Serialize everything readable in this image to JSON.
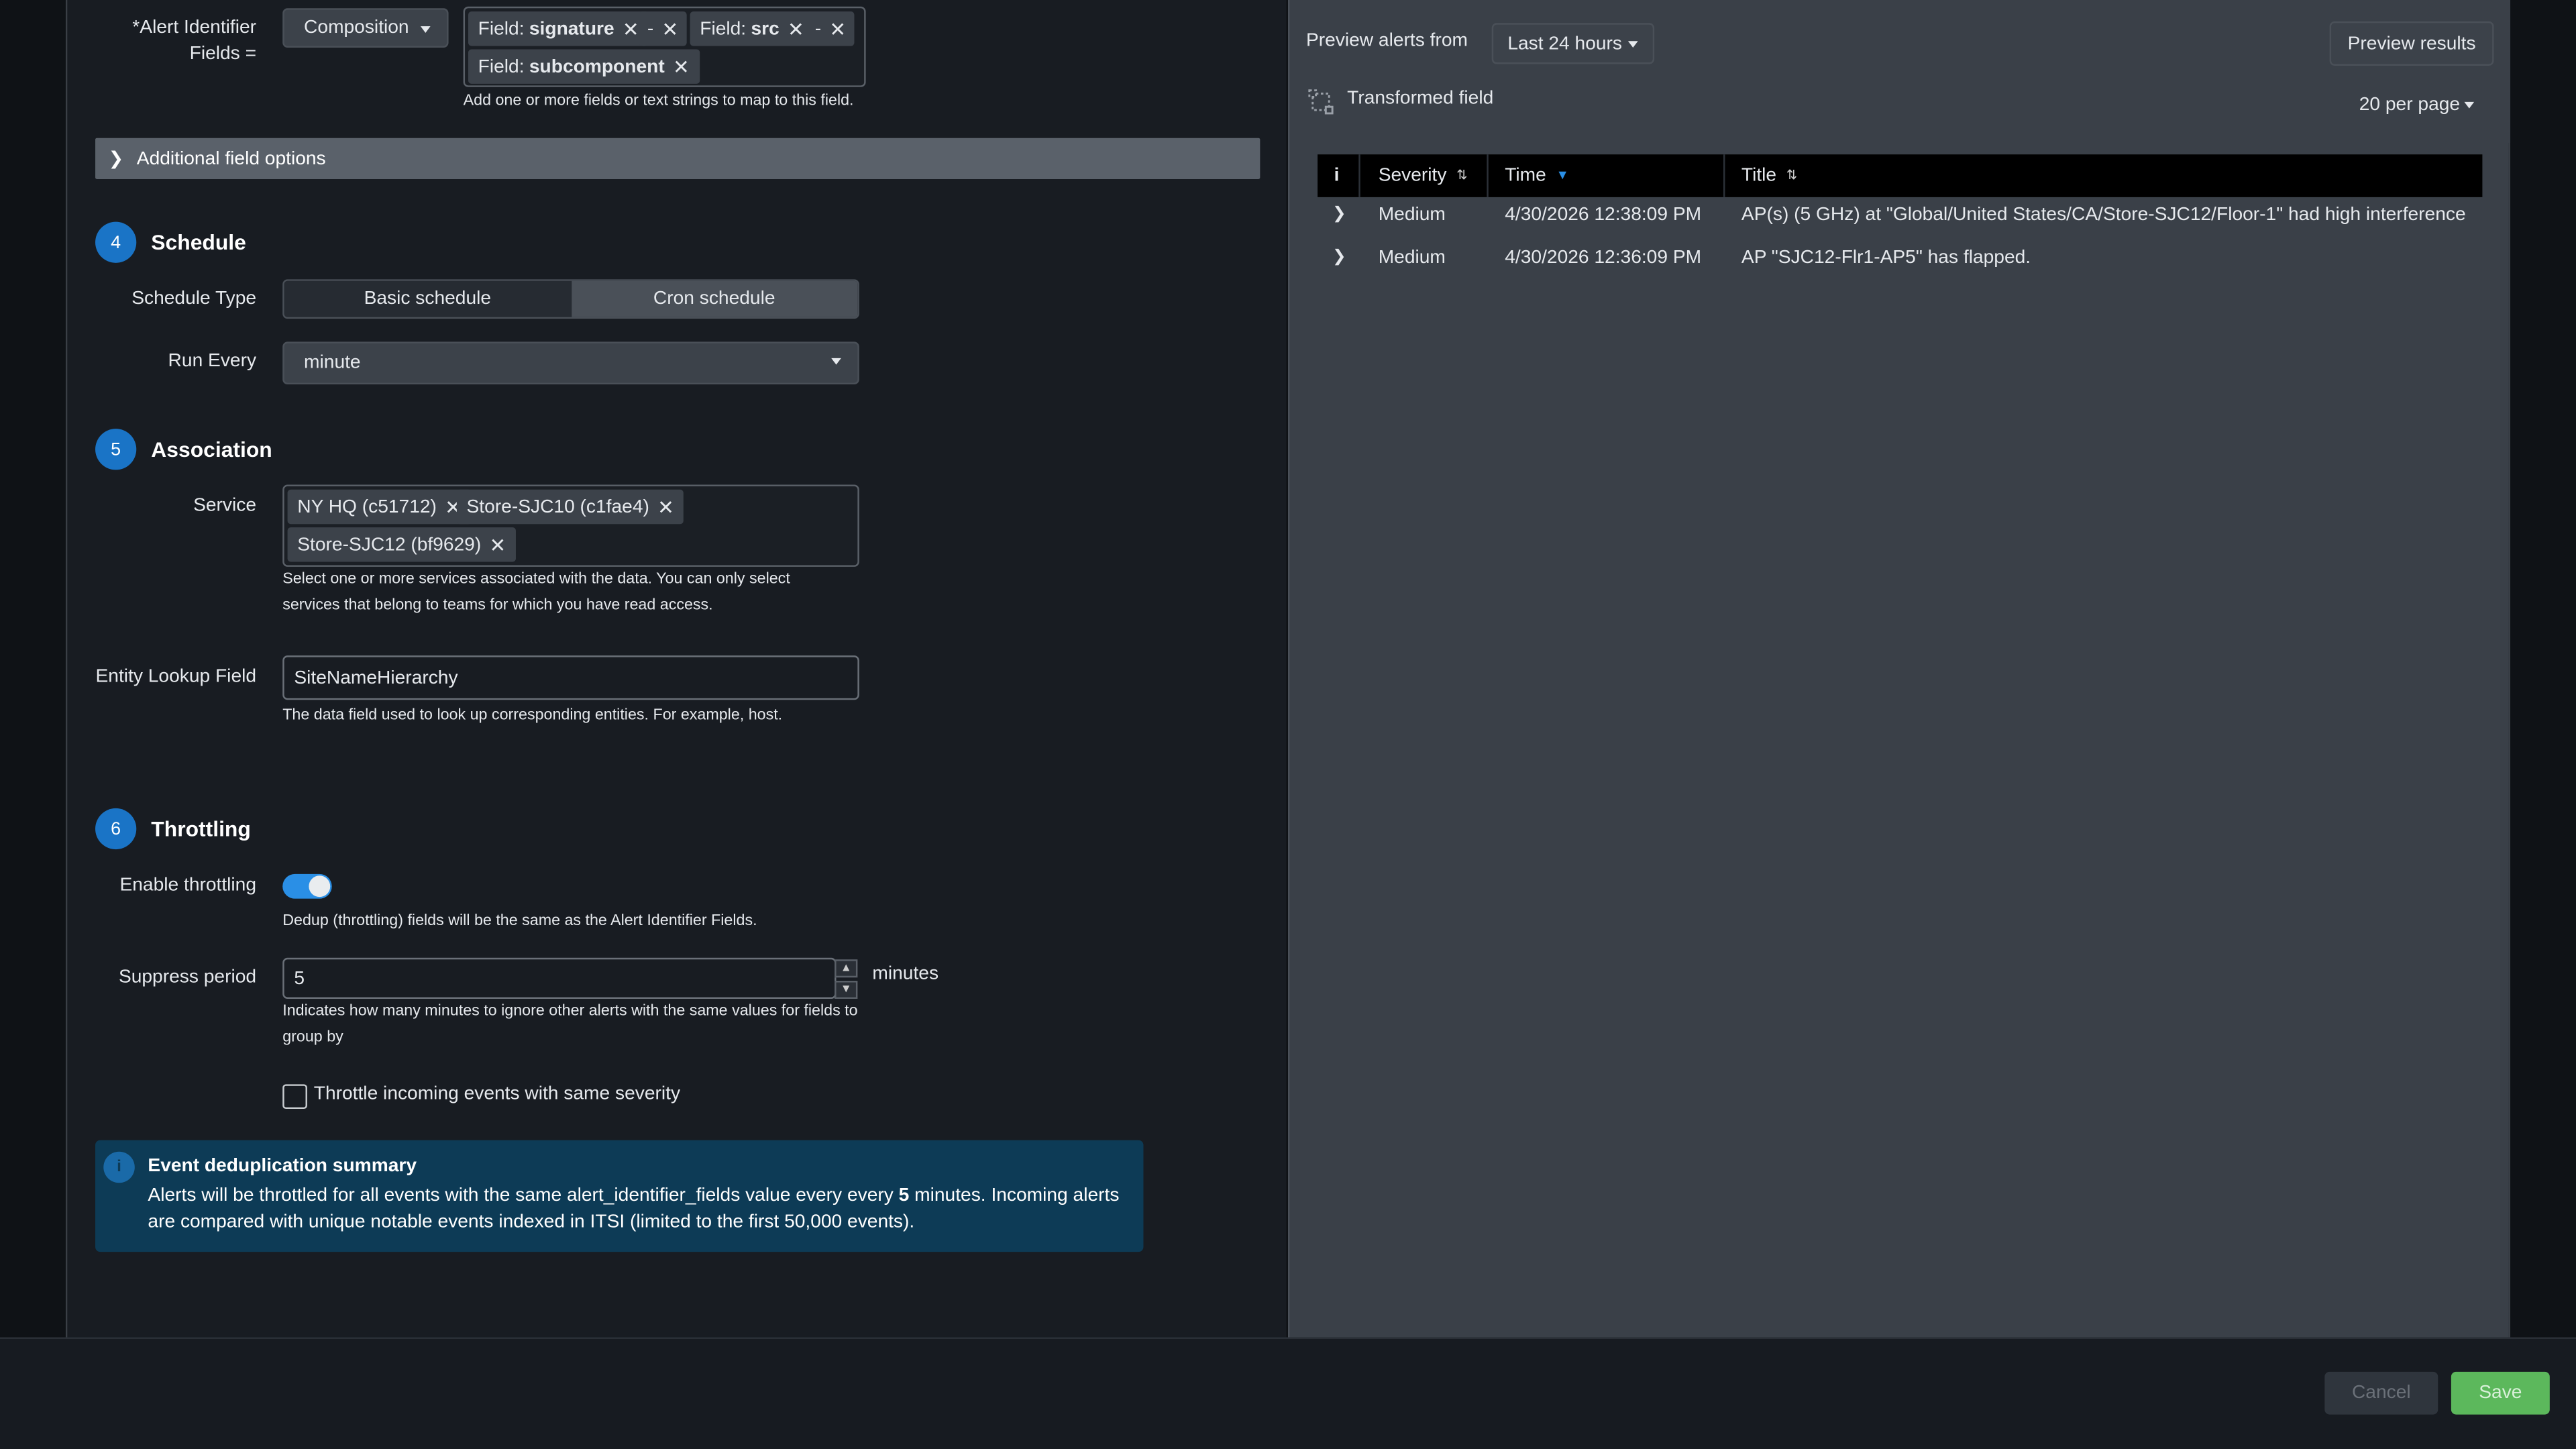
{
  "mapping": {
    "alert_id_label_req": "*",
    "alert_id_label_line1": "Alert Identifier",
    "alert_id_label_line2": "Fields =",
    "composition_label": "Composition",
    "tags": [
      {
        "prefix": "Field:",
        "value": "signature"
      },
      {
        "prefix": "-",
        "value": ""
      },
      {
        "prefix": "Field:",
        "value": "src"
      },
      {
        "prefix": "-",
        "value": ""
      },
      {
        "prefix": "Field:",
        "value": "subcomponent"
      }
    ],
    "tags_help": "Add one or more fields or text strings to map to this field.",
    "additional_options": "Additional field options"
  },
  "schedule": {
    "step": "4",
    "title": "Schedule",
    "type_label": "Schedule Type",
    "options": [
      "Basic schedule",
      "Cron schedule"
    ],
    "run_every_label": "Run Every",
    "run_every_value": "minute"
  },
  "association": {
    "step": "5",
    "title": "Association",
    "service_label": "Service",
    "services": [
      "NY HQ (c51712)",
      "Store-SJC10 (c1fae4)",
      "Store-SJC12 (bf9629)"
    ],
    "service_help_1": "Select one or more services associated with the data. You can only select",
    "service_help_2": "services that belong to teams for which you have read access.",
    "entity_label": "Entity Lookup Field",
    "entity_value": "SiteNameHierarchy",
    "entity_help": "The data field used to look up corresponding entities. For example, host."
  },
  "throttling": {
    "step": "6",
    "title": "Throttling",
    "enable_label": "Enable throttling",
    "enabled": true,
    "dedup_help": "Dedup (throttling) fields will be the same as the Alert Identifier Fields.",
    "suppress_label": "Suppress period",
    "suppress_value": "5",
    "suppress_unit": "minutes",
    "suppress_help_1": "Indicates how many minutes to ignore other alerts with the same values for fields to",
    "suppress_help_2": "group by",
    "checkbox_label": "Throttle incoming events with same severity",
    "checkbox_checked": false
  },
  "summary": {
    "icon": "i",
    "title": "Event deduplication summary",
    "text_1": "Alerts will be throttled for all events with the same alert_identifier_fields value every every ",
    "text_bold": "5",
    "text_2": " minutes. Incoming alerts are compared with unique notable events indexed in ITSI (limited to the first 50,000 events)."
  },
  "preview": {
    "from_label": "Preview alerts from",
    "range": "Last 24 hours",
    "preview_button": "Preview results",
    "transformed": "Transformed field",
    "per_page": "20 per page",
    "columns": {
      "info": "i",
      "severity": "Severity",
      "time": "Time",
      "title": "Title"
    },
    "rows": [
      {
        "severity": "Medium",
        "time": "4/30/2026 12:38:09 PM",
        "title": "AP(s) (5 GHz) at \"Global/United States/CA/Store-SJC12/Floor-1\" had high interference"
      },
      {
        "severity": "Medium",
        "time": "4/30/2026 12:36:09 PM",
        "title": "AP \"SJC12-Flr1-AP5\" has flapped."
      }
    ]
  },
  "footer": {
    "cancel": "Cancel",
    "save": "Save"
  },
  "colors": {
    "accent": "#1a74c6",
    "toggle": "#2a8fe6",
    "save": "#5cb85c",
    "info_bg": "#0d3b56"
  }
}
